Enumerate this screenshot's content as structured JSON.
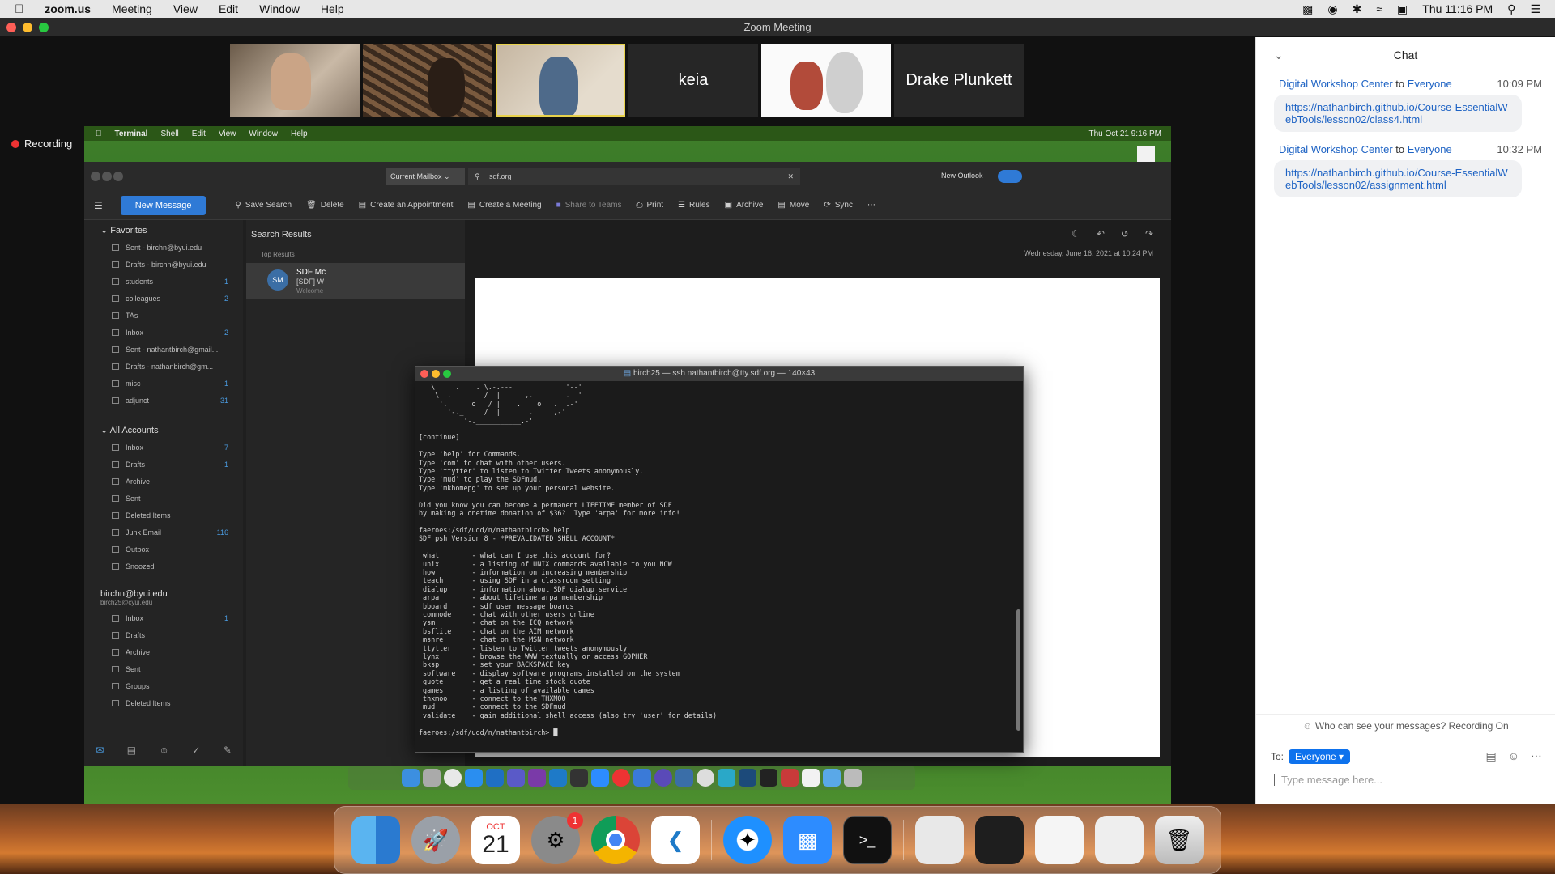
{
  "host_menubar": {
    "app": "zoom.us",
    "items": [
      "Meeting",
      "View",
      "Edit",
      "Window",
      "Help"
    ],
    "clock": "Thu 11:16 PM"
  },
  "zoom": {
    "window_title": "Zoom Meeting",
    "recording_label": "Recording",
    "participants": [
      {
        "name": "",
        "kind": "video"
      },
      {
        "name": "",
        "kind": "video"
      },
      {
        "name": "",
        "kind": "video",
        "active": true
      },
      {
        "name": "keia",
        "kind": "name"
      },
      {
        "name": "",
        "kind": "video"
      },
      {
        "name": "Drake Plunkett",
        "kind": "name"
      }
    ]
  },
  "shared_screen": {
    "menubar": {
      "app": "Terminal",
      "items": [
        "Shell",
        "Edit",
        "View",
        "Window",
        "Help"
      ],
      "clock": "Thu Oct 21  9:16 PM"
    },
    "outlook": {
      "mailbox_selector": "Current Mailbox",
      "search_value": "sdf.org",
      "new_outlook_label": "New Outlook",
      "new_message": "New Message",
      "toolbar": [
        "Save Search",
        "Delete",
        "Create an Appointment",
        "Create a Meeting",
        "Share to Teams",
        "Print",
        "Rules",
        "Archive",
        "Move",
        "Sync"
      ],
      "favorites_label": "Favorites",
      "favorites": [
        {
          "label": "Sent - birchn@byui.edu",
          "count": ""
        },
        {
          "label": "Drafts - birchn@byui.edu",
          "count": ""
        },
        {
          "label": "students",
          "count": "1"
        },
        {
          "label": "colleagues",
          "count": "2"
        },
        {
          "label": "TAs",
          "count": ""
        },
        {
          "label": "Inbox",
          "count": "2"
        },
        {
          "label": "Sent - nathantbirch@gmail...",
          "count": ""
        },
        {
          "label": "Drafts - nathanbirch@gm...",
          "count": ""
        },
        {
          "label": "misc",
          "count": "1"
        },
        {
          "label": "adjunct",
          "count": "31"
        }
      ],
      "all_accounts_label": "All Accounts",
      "all_accounts": [
        {
          "label": "Inbox",
          "count": "7"
        },
        {
          "label": "Drafts",
          "count": "1"
        },
        {
          "label": "Archive",
          "count": ""
        },
        {
          "label": "Sent",
          "count": ""
        },
        {
          "label": "Deleted Items",
          "count": ""
        },
        {
          "label": "Junk Email",
          "count": "116"
        },
        {
          "label": "Outbox",
          "count": ""
        },
        {
          "label": "Snoozed",
          "count": ""
        }
      ],
      "account_name": "birchn@byui.edu",
      "account_sub": "birch25@cyui.edu",
      "account_items": [
        {
          "label": "Inbox",
          "count": "1"
        },
        {
          "label": "Drafts",
          "count": ""
        },
        {
          "label": "Archive",
          "count": ""
        },
        {
          "label": "Sent",
          "count": ""
        },
        {
          "label": "Groups",
          "count": ""
        },
        {
          "label": "Deleted Items",
          "count": ""
        }
      ],
      "list_header": "Search Results",
      "list_sub": "Top Results",
      "list_item": {
        "avatar": "SM",
        "from": "SDF Mc",
        "subject": "[SDF] W",
        "preview": "Welcome"
      },
      "reading_date": "Wednesday, June 16, 2021 at 10:24 PM"
    },
    "terminal": {
      "title": "birch25 — ssh nathantbirch@tty.sdf.org — 140×43",
      "lines": [
        "   \\     .    . \\.-.---             '--'",
        "    \\  .        /  |      ,.        .  '",
        "     '.      o   / |    .    o   .  .-'",
        "       '-._     /  |       .     ,-'",
        "           '-.___________.-'",
        "",
        "[continue]",
        "",
        "Type 'help' for Commands.",
        "Type 'com' to chat with other users.",
        "Type 'ttytter' to listen to Twitter Tweets anonymously.",
        "Type 'mud' to play the SDFmud.",
        "Type 'mkhomepg' to set up your personal website.",
        "",
        "Did you know you can become a permanent LIFETIME member of SDF",
        "by making a onetime donation of $36?  Type 'arpa' for more info!",
        "",
        "faeroes:/sdf/udd/n/nathantbirch> help",
        "SDF psh Version 8 - *PREVALIDATED SHELL ACCOUNT*",
        "",
        " what        - what can I use this account for?",
        " unix        - a listing of UNIX commands available to you NOW",
        " how         - information on increasing membership",
        " teach       - using SDF in a classroom setting",
        " dialup      - information about SDF dialup service",
        " arpa        - about lifetime arpa membership",
        " bboard      - sdf user message boards",
        " commode     - chat with other users online",
        " ysm         - chat on the ICQ network",
        " bsflite     - chat on the AIM network",
        " msnre       - chat on the MSN network",
        " ttytter     - listen to Twitter tweets anonymously",
        " lynx        - browse the WWW textually or access GOPHER",
        " bksp        - set your BACKSPACE key",
        " software    - display software programs installed on the system",
        " quote       - get a real time stock quote",
        " games       - a listing of available games",
        " thxmoo      - connect to the THXMOO",
        " mud         - connect to the SDFmud",
        " validate    - gain additional shell access (also try 'user' for details)",
        "",
        "faeroes:/sdf/udd/n/nathantbirch> █"
      ]
    }
  },
  "chat": {
    "title": "Chat",
    "messages": [
      {
        "from": "Digital Workshop Center",
        "to_word": "to",
        "to": "Everyone",
        "time": "10:09 PM",
        "text": "https://nathanbirch.github.io/Course-EssentialWebTools/lesson02/class4.html"
      },
      {
        "from": "Digital Workshop Center",
        "to_word": "to",
        "to": "Everyone",
        "time": "10:32 PM",
        "text": "https://nathanbirch.github.io/Course-EssentialWebTools/lesson02/assignment.html"
      }
    ],
    "visibility_note": "Who can see your messages? Recording On",
    "to_label": "To:",
    "recipient": "Everyone",
    "input_placeholder": "Type message here..."
  },
  "dock": {
    "calendar_month": "OCT",
    "calendar_day": "21",
    "settings_badge": "1",
    "terminal_prompt": ">_"
  },
  "colors": {
    "zoom_blue": "#0e72ed",
    "recording_red": "#e33333",
    "outlook_blue": "#2f7ad6",
    "link_blue": "#1e63c4"
  }
}
